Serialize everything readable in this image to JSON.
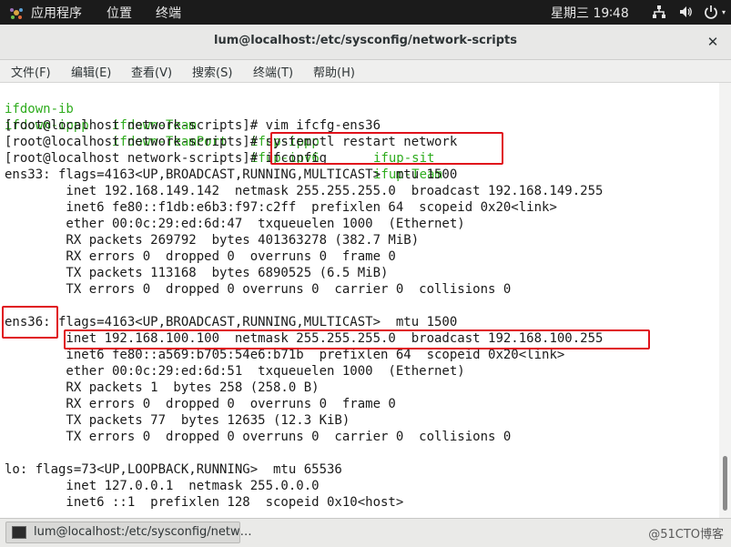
{
  "topbar": {
    "apps": "应用程序",
    "places": "位置",
    "terminal": "终端",
    "clock": "星期三 19∶48"
  },
  "window": {
    "title": "lum@localhost:/etc/sysconfig/network-scripts",
    "close": "✕"
  },
  "menu": [
    "文件(F)",
    "编辑(E)",
    "查看(V)",
    "搜索(S)",
    "终端(T)",
    "帮助(H)"
  ],
  "terminal": {
    "row1": [
      "ifdown-ib",
      "ifdown-Team",
      "ifup-ippp",
      "ifup-sit"
    ],
    "row2": [
      "ifdown-ippp",
      "ifdown-TeamPort",
      "ifup-ipv6",
      "ifup-Team"
    ],
    "lines": [
      "[root@localhost network-scripts]# vim ifcfg-ens36",
      "[root@localhost network-scripts]# systemctl restart network",
      "[root@localhost network-scripts]# ifconfig",
      "ens33: flags=4163<UP,BROADCAST,RUNNING,MULTICAST>  mtu 1500",
      "        inet 192.168.149.142  netmask 255.255.255.0  broadcast 192.168.149.255",
      "        inet6 fe80::f1db:e6b3:f97:c2ff  prefixlen 64  scopeid 0x20<link>",
      "        ether 00:0c:29:ed:6d:47  txqueuelen 1000  (Ethernet)",
      "        RX packets 269792  bytes 401363278 (382.7 MiB)",
      "        RX errors 0  dropped 0  overruns 0  frame 0",
      "        TX packets 113168  bytes 6890525 (6.5 MiB)",
      "        TX errors 0  dropped 0 overruns 0  carrier 0  collisions 0",
      "",
      "ens36: flags=4163<UP,BROADCAST,RUNNING,MULTICAST>  mtu 1500",
      "        inet 192.168.100.100  netmask 255.255.255.0  broadcast 192.168.100.255",
      "        inet6 fe80::a569:b705:54e6:b71b  prefixlen 64  scopeid 0x20<link>",
      "        ether 00:0c:29:ed:6d:51  txqueuelen 1000  (Ethernet)",
      "        RX packets 1  bytes 258 (258.0 B)",
      "        RX errors 0  dropped 0  overruns 0  frame 0",
      "        TX packets 77  bytes 12635 (12.3 KiB)",
      "        TX errors 0  dropped 0 overruns 0  carrier 0  collisions 0",
      "",
      "lo: flags=73<UP,LOOPBACK,RUNNING>  mtu 65536",
      "        inet 127.0.0.1  netmask 255.0.0.0",
      "        inet6 ::1  prefixlen 128  scopeid 0x10<host>"
    ]
  },
  "taskbar": {
    "item": "lum@localhost:/etc/sysconfig/netw…",
    "watermark": "@51CTO博客"
  },
  "colors": {
    "highlight": "#e0121b",
    "green_text": "#2eac1d",
    "topbar_bg": "#1b1b1b"
  }
}
